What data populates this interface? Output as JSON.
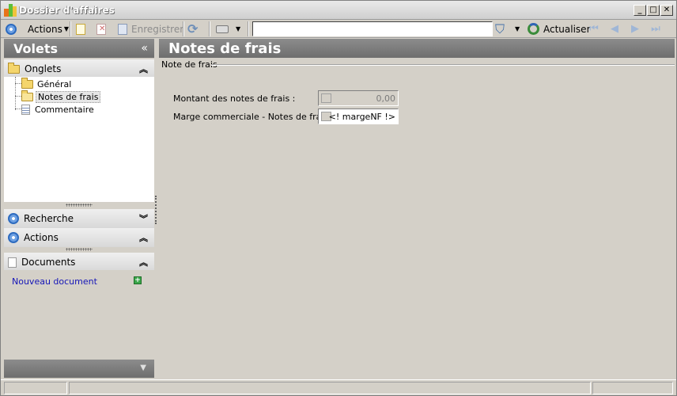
{
  "window": {
    "title": "Dossier d'affaires",
    "controls": {
      "minimize": "_",
      "maximize": "□",
      "close": "✕"
    }
  },
  "toolbar": {
    "actions_label": "Actions",
    "save_label": "Enregistrer",
    "search_value": "",
    "refresh_label": "Actualiser"
  },
  "left_panel": {
    "title": "Volets",
    "tabs_section": {
      "label": "Onglets",
      "items": [
        {
          "label": "Général",
          "icon": "folder-closed-icon"
        },
        {
          "label": "Notes de frais",
          "icon": "folder-open-icon",
          "selected": true
        },
        {
          "label": "Commentaire",
          "icon": "document-icon"
        }
      ]
    },
    "search_section": {
      "label": "Recherche"
    },
    "actions_section": {
      "label": "Actions"
    },
    "documents_section": {
      "label": "Documents",
      "new_document_link": "Nouveau document"
    }
  },
  "main": {
    "title": "Notes de frais",
    "group_label": "Note de frais",
    "fields": [
      {
        "label": "Montant des notes de frais :",
        "value": "0,00"
      },
      {
        "label": "Marge commerciale - Notes de frais :",
        "value": "<! margeNF !>"
      }
    ]
  },
  "colors": {
    "header_bg": "#7d7d7d",
    "window_bg": "#d4d0c8",
    "link": "#1515b8"
  }
}
